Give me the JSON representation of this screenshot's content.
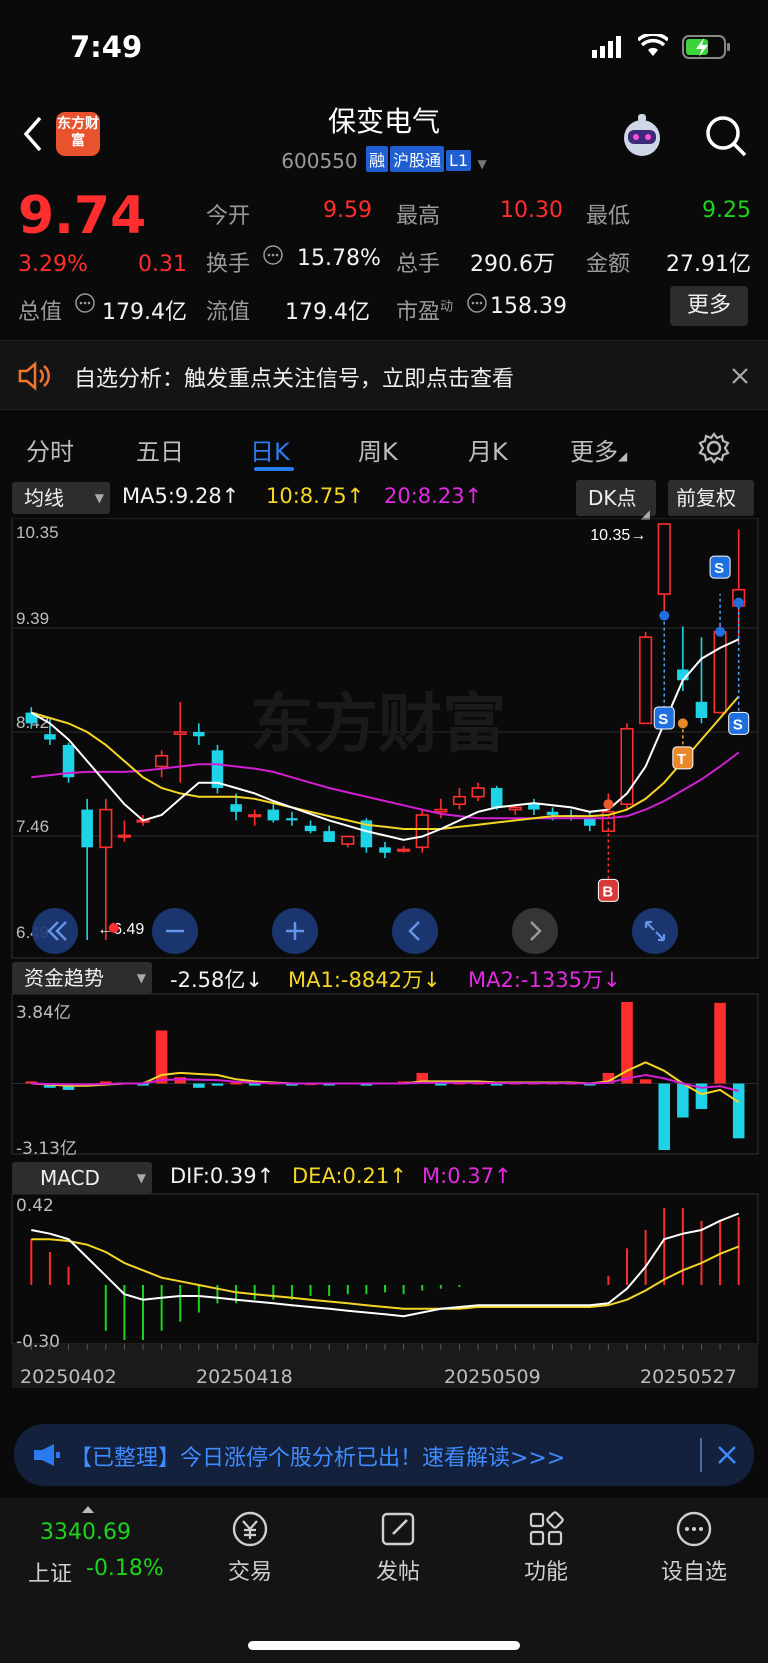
{
  "status": {
    "time": "7:49"
  },
  "header": {
    "title": "保变电气",
    "code": "600550",
    "tags": [
      "融",
      "沪股通",
      "L1"
    ],
    "logo": "东方财富"
  },
  "quote": {
    "price": "9.74",
    "pct": "3.29%",
    "chg": "0.31",
    "open_l": "今开",
    "open": "9.59",
    "high_l": "最高",
    "high": "10.30",
    "low_l": "最低",
    "low": "9.25",
    "turn_l": "换手",
    "turn": "15.78%",
    "vol_l": "总手",
    "vol": "290.6万",
    "amt_l": "金额",
    "amt": "27.91亿",
    "mcap_l": "总值",
    "mcap": "179.4亿",
    "float_l": "流值",
    "float": "179.4亿",
    "pe_l": "市盈",
    "pe_sup": "动",
    "pe": "158.39",
    "more": "更多"
  },
  "notice": {
    "text": "自选分析：触发重点关注信号，立即点击查看"
  },
  "tabs": [
    "分时",
    "五日",
    "日K",
    "周K",
    "月K",
    "更多"
  ],
  "kline": {
    "indicator": "均线",
    "ma5": "MA5:9.28↑",
    "ma10": "10:8.75↑",
    "ma20": "20:8.23↑",
    "dk": "DK点",
    "adj": "前复权",
    "yticks": [
      "10.35",
      "9.39",
      "8.42",
      "7.46",
      "6.49"
    ],
    "max_label": "10.35→",
    "min_label": "←6.49",
    "watermark": "东方财富"
  },
  "fund": {
    "indicator": "资金趋势",
    "value": "-2.58亿↓",
    "ma1": "MA1:-8842万↓",
    "ma2": "MA2:-1335万↓",
    "ymax": "3.84亿",
    "ymin": "-3.13亿"
  },
  "macd": {
    "indicator": "MACD",
    "dif": "DIF:0.39↑",
    "dea": "DEA:0.21↑",
    "m": "M:0.37↑",
    "ymax": "0.42",
    "ymin": "-0.30"
  },
  "dates": [
    "20250402",
    "20250418",
    "20250509",
    "20250527"
  ],
  "banner": {
    "text": "【已整理】今日涨停个股分析已出！速看解读>>>"
  },
  "index": {
    "value": "3340.69",
    "name": "上证",
    "pct": "-0.18%"
  },
  "nav": [
    "交易",
    "发帖",
    "功能",
    "设自选"
  ],
  "colors": {
    "up": "#ff2e2e",
    "down": "#1fd3e6",
    "ma5": "#ffffff",
    "ma10": "#f5d524",
    "ma20": "#d21fd2",
    "accent": "#2b7bf0"
  },
  "chart_data": {
    "type": "candlestick",
    "candles": [
      [
        8.6,
        8.5,
        8.65,
        8.45
      ],
      [
        8.4,
        8.35,
        8.55,
        8.3
      ],
      [
        8.3,
        8.0,
        8.32,
        7.95
      ],
      [
        7.7,
        7.35,
        7.8,
        6.49
      ],
      [
        7.35,
        7.7,
        7.8,
        6.49
      ],
      [
        7.45,
        7.46,
        7.6,
        7.4
      ],
      [
        7.6,
        7.6,
        7.65,
        7.55
      ],
      [
        8.1,
        8.2,
        8.25,
        8.0
      ],
      [
        8.4,
        8.42,
        8.7,
        7.95
      ],
      [
        8.42,
        8.38,
        8.5,
        8.3
      ],
      [
        8.25,
        7.9,
        8.3,
        7.85
      ],
      [
        7.75,
        7.68,
        7.85,
        7.6
      ],
      [
        7.65,
        7.65,
        7.7,
        7.55
      ],
      [
        7.7,
        7.6,
        7.75,
        7.58
      ],
      [
        7.62,
        7.6,
        7.68,
        7.55
      ],
      [
        7.55,
        7.5,
        7.6,
        7.48
      ],
      [
        7.5,
        7.4,
        7.55,
        7.4
      ],
      [
        7.38,
        7.45,
        7.46,
        7.35
      ],
      [
        7.6,
        7.35,
        7.62,
        7.3
      ],
      [
        7.35,
        7.3,
        7.4,
        7.25
      ],
      [
        7.32,
        7.33,
        7.36,
        7.3
      ],
      [
        7.35,
        7.65,
        7.7,
        7.3
      ],
      [
        7.68,
        7.7,
        7.8,
        7.62
      ],
      [
        7.75,
        7.82,
        7.9,
        7.7
      ],
      [
        7.82,
        7.9,
        7.95,
        7.78
      ],
      [
        7.9,
        7.72,
        7.92,
        7.7
      ],
      [
        7.7,
        7.72,
        7.75,
        7.65
      ],
      [
        7.75,
        7.7,
        7.8,
        7.65
      ],
      [
        7.68,
        7.65,
        7.72,
        7.6
      ],
      [
        7.65,
        7.64,
        7.7,
        7.6
      ],
      [
        7.62,
        7.55,
        7.68,
        7.5
      ],
      [
        7.5,
        7.68,
        7.85,
        7.5
      ],
      [
        7.75,
        8.45,
        8.5,
        7.7
      ],
      [
        8.5,
        9.3,
        9.35,
        8.5
      ],
      [
        9.7,
        10.35,
        10.35,
        9.5
      ],
      [
        9.0,
        8.9,
        9.4,
        8.8
      ],
      [
        8.7,
        8.55,
        9.3,
        8.5
      ],
      [
        8.6,
        9.35,
        9.42,
        8.6
      ],
      [
        9.59,
        9.74,
        10.3,
        9.25
      ]
    ],
    "ma5": [
      8.6,
      8.5,
      8.35,
      8.15,
      7.95,
      7.75,
      7.6,
      7.65,
      7.8,
      7.95,
      7.95,
      7.9,
      7.85,
      7.78,
      7.72,
      7.66,
      7.6,
      7.55,
      7.5,
      7.46,
      7.42,
      7.45,
      7.52,
      7.6,
      7.68,
      7.72,
      7.74,
      7.76,
      7.74,
      7.72,
      7.68,
      7.7,
      7.85,
      8.1,
      8.5,
      8.9,
      9.1,
      9.2,
      9.28
    ],
    "ma10": [
      8.6,
      8.55,
      8.5,
      8.42,
      8.3,
      8.15,
      8.0,
      7.9,
      7.85,
      7.82,
      7.82,
      7.82,
      7.8,
      7.76,
      7.72,
      7.68,
      7.64,
      7.6,
      7.56,
      7.54,
      7.52,
      7.52,
      7.52,
      7.54,
      7.56,
      7.58,
      7.6,
      7.62,
      7.64,
      7.64,
      7.64,
      7.65,
      7.7,
      7.8,
      7.95,
      8.15,
      8.35,
      8.55,
      8.75
    ],
    "ma20": [
      8.0,
      8.02,
      8.04,
      8.05,
      8.05,
      8.05,
      8.06,
      8.08,
      8.1,
      8.12,
      8.12,
      8.1,
      8.08,
      8.05,
      8.0,
      7.95,
      7.9,
      7.86,
      7.82,
      7.78,
      7.74,
      7.7,
      7.66,
      7.64,
      7.62,
      7.62,
      7.62,
      7.62,
      7.62,
      7.62,
      7.62,
      7.62,
      7.64,
      7.7,
      7.78,
      7.88,
      7.98,
      8.1,
      8.23
    ],
    "fund": [
      0.1,
      -0.2,
      -0.3,
      -0.1,
      0.1,
      0.05,
      -0.1,
      2.5,
      0.3,
      -0.2,
      -0.1,
      0.05,
      -0.05,
      0.05,
      -0.1,
      0.02,
      -0.05,
      0.05,
      -0.1,
      0.05,
      0.1,
      0.5,
      -0.05,
      0.05,
      0.05,
      -0.05,
      0.05,
      0.05,
      0.05,
      0.05,
      -0.05,
      0.5,
      3.84,
      0.2,
      -3.13,
      -1.6,
      -1.2,
      3.8,
      -2.58
    ],
    "fund_ma": [
      0.0,
      -0.05,
      -0.1,
      -0.1,
      -0.05,
      0.0,
      0.0,
      0.4,
      0.5,
      0.45,
      0.4,
      0.2,
      0.1,
      0.05,
      0.0,
      0.0,
      0.0,
      0.0,
      0.0,
      0.0,
      0.0,
      0.1,
      0.1,
      0.1,
      0.1,
      0.05,
      0.05,
      0.05,
      0.05,
      0.05,
      0.0,
      0.1,
      0.6,
      1.0,
      0.6,
      0.0,
      -0.5,
      -0.3,
      -0.88
    ],
    "macd_m": [
      0.25,
      0.18,
      0.1,
      0.0,
      -0.25,
      -0.3,
      -0.3,
      -0.25,
      -0.2,
      -0.15,
      -0.1,
      -0.1,
      -0.08,
      -0.08,
      -0.08,
      -0.06,
      -0.06,
      -0.05,
      -0.05,
      -0.04,
      -0.05,
      -0.03,
      -0.02,
      -0.01,
      0.0,
      0.0,
      0.0,
      0.0,
      0.0,
      0.0,
      0.0,
      0.05,
      0.2,
      0.3,
      0.42,
      0.42,
      0.35,
      0.35,
      0.37
    ],
    "dif": [
      0.3,
      0.28,
      0.25,
      0.15,
      0.05,
      -0.05,
      -0.08,
      -0.07,
      -0.06,
      -0.06,
      -0.07,
      -0.08,
      -0.09,
      -0.1,
      -0.11,
      -0.12,
      -0.13,
      -0.14,
      -0.15,
      -0.16,
      -0.17,
      -0.15,
      -0.13,
      -0.12,
      -0.11,
      -0.11,
      -0.11,
      -0.11,
      -0.11,
      -0.11,
      -0.11,
      -0.1,
      -0.02,
      0.1,
      0.25,
      0.28,
      0.3,
      0.35,
      0.39
    ],
    "dea": [
      0.25,
      0.25,
      0.24,
      0.22,
      0.18,
      0.12,
      0.08,
      0.04,
      0.02,
      0.0,
      -0.02,
      -0.04,
      -0.05,
      -0.06,
      -0.07,
      -0.08,
      -0.09,
      -0.1,
      -0.11,
      -0.12,
      -0.13,
      -0.13,
      -0.13,
      -0.13,
      -0.12,
      -0.12,
      -0.12,
      -0.12,
      -0.12,
      -0.12,
      -0.12,
      -0.11,
      -0.08,
      -0.03,
      0.03,
      0.08,
      0.12,
      0.17,
      0.21
    ],
    "ylim": [
      6.49,
      10.35
    ]
  }
}
